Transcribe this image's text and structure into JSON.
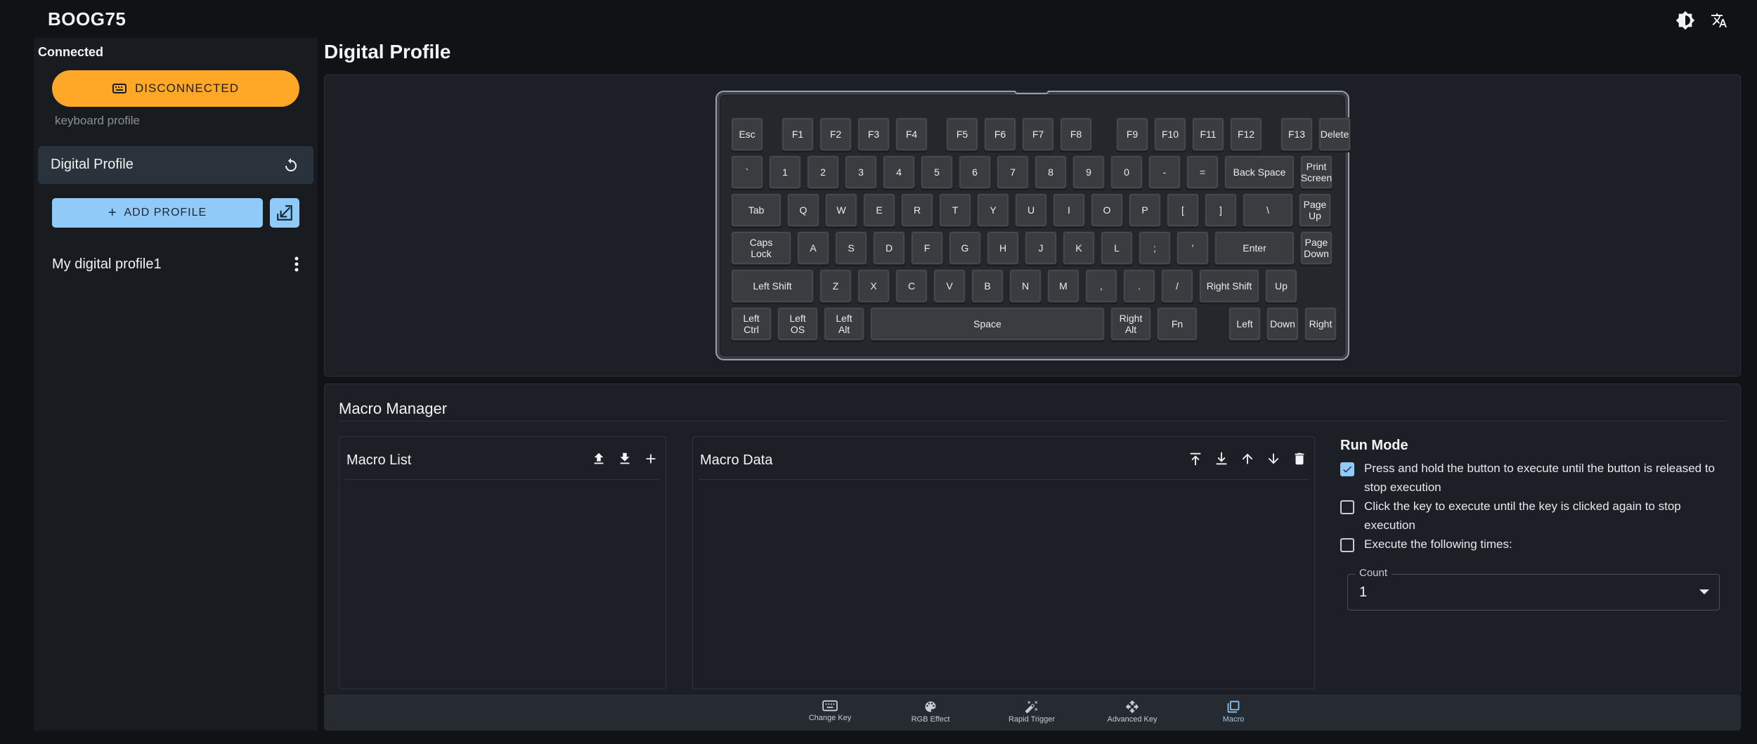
{
  "app": {
    "title": "BOOG75"
  },
  "sidebar": {
    "status": "Connected",
    "disconnect_label": "DISCONNECTED",
    "section_label": "keyboard profile",
    "selected_profile": "Digital Profile",
    "add_profile_label": "ADD PROFILE",
    "profiles": [
      {
        "name": "My digital profile1"
      }
    ]
  },
  "main": {
    "title": "Digital Profile",
    "keyboard": {
      "rows": [
        [
          "Esc",
          "F1",
          "F2",
          "F3",
          "F4",
          "F5",
          "F6",
          "F7",
          "F8",
          "F9",
          "F10",
          "F11",
          "F12",
          "F13",
          "Delete"
        ],
        [
          "`",
          "1",
          "2",
          "3",
          "4",
          "5",
          "6",
          "7",
          "8",
          "9",
          "0",
          "-",
          "=",
          "Back Space",
          "Print\nScreen"
        ],
        [
          "Tab",
          "Q",
          "W",
          "E",
          "R",
          "T",
          "Y",
          "U",
          "I",
          "O",
          "P",
          "[",
          "]",
          "\\",
          "Page\nUp"
        ],
        [
          "Caps\nLock",
          "A",
          "S",
          "D",
          "F",
          "G",
          "H",
          "J",
          "K",
          "L",
          ";",
          "'",
          "Enter",
          "Page\nDown"
        ],
        [
          "Left Shift",
          "Z",
          "X",
          "C",
          "V",
          "B",
          "N",
          "M",
          ",",
          ".",
          "/",
          "Right Shift",
          "Up"
        ],
        [
          "Left\nCtrl",
          "Left\nOS",
          "Left\nAlt",
          "Space",
          "Right\nAlt",
          "Fn",
          "Left",
          "Down",
          "Right"
        ]
      ]
    },
    "macro": {
      "title": "Macro Manager",
      "list_title": "Macro List",
      "data_title": "Macro Data",
      "run_mode": {
        "title": "Run Mode",
        "options": [
          {
            "label": "Press and hold the button to execute until the button is released to stop execution",
            "checked": true
          },
          {
            "label": "Click the key to execute until the key is clicked again to stop execution",
            "checked": false
          },
          {
            "label": "Execute the following times:",
            "checked": false
          }
        ],
        "count_label": "Count",
        "count_value": "1"
      }
    },
    "nav": {
      "items": [
        {
          "label": "Change Key",
          "icon": "keyboard-icon"
        },
        {
          "label": "RGB Effect",
          "icon": "palette-icon"
        },
        {
          "label": "Rapid Trigger",
          "icon": "magic-wand-icon"
        },
        {
          "label": "Advanced Key",
          "icon": "move-arrows-icon"
        },
        {
          "label": "Macro",
          "icon": "copy-stack-icon",
          "active": true
        }
      ]
    }
  },
  "colors": {
    "accent": "#90caf9",
    "warning": "#ffa726",
    "background": "#101216"
  }
}
